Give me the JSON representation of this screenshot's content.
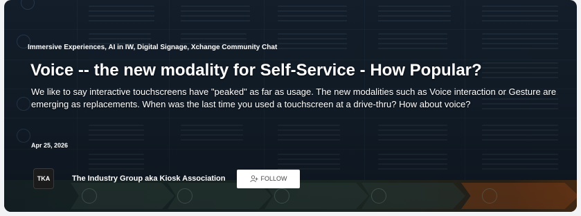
{
  "post": {
    "categories": "Immersive Experiences, AI in IW, Digital Signage, Xchange Community Chat",
    "title": "Voice -- the new modality for Self-Service - How Popular?",
    "excerpt": "We like to say interactive touchscreens have \"peaked\" as far as usage.  The new modalities such as Voice interaction or Gesture are emerging as replacements.  When was the last time you used a touchscreen at a drive-thru? How about voice?",
    "date": "Apr 25, 2026"
  },
  "author": {
    "name": "The Industry Group aka Kiosk Association",
    "avatar_text": "TKA"
  },
  "follow": {
    "label": "FOLLOW",
    "icon": "add-user-icon"
  },
  "colors": {
    "card_background": "#162230",
    "accent_orange": "#c85a14",
    "text": "#ffffff"
  }
}
